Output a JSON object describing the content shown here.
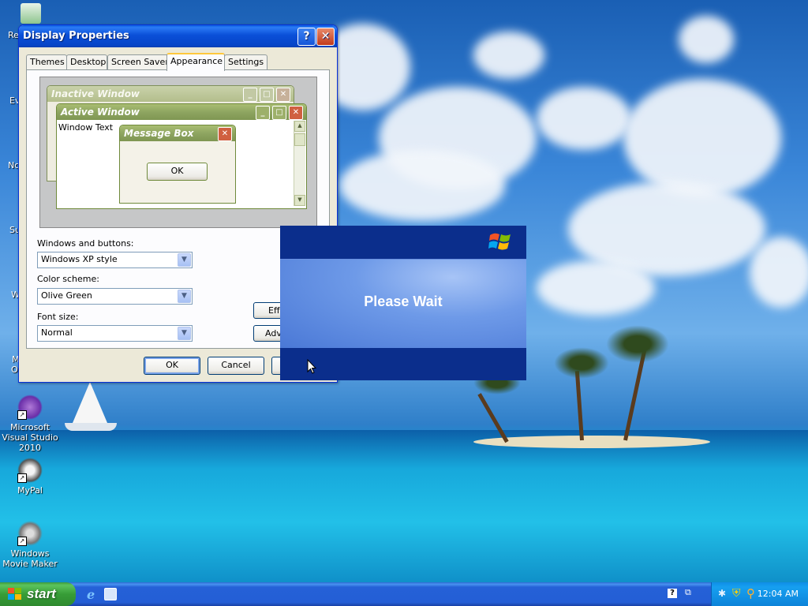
{
  "desktop": {
    "icons": [
      {
        "label": "Microsoft Visual Studio 2010"
      },
      {
        "label": "MyPal"
      },
      {
        "label": "Windows Movie Maker"
      }
    ],
    "partial_labels": [
      "Re",
      "Ev",
      "Nc",
      "Su",
      "W",
      "M",
      "O"
    ]
  },
  "display_properties": {
    "title": "Display Properties",
    "help_glyph": "?",
    "close_glyph": "✕",
    "tabs": [
      "Themes",
      "Desktop",
      "Screen Saver",
      "Appearance",
      "Settings"
    ],
    "active_tab": "Appearance",
    "preview": {
      "inactive_title": "Inactive Window",
      "active_title": "Active Window",
      "window_text": "Window Text",
      "msgbox_title": "Message Box",
      "msgbox_ok": "OK"
    },
    "windows_buttons_label": "Windows and buttons:",
    "windows_buttons_value": "Windows XP style",
    "color_scheme_label": "Color scheme:",
    "color_scheme_value": "Olive Green",
    "font_size_label": "Font size:",
    "font_size_value": "Normal",
    "effects_button": "Effe",
    "advanced_button": "Adv",
    "ok_button": "OK",
    "cancel_button": "Cancel"
  },
  "please_wait": {
    "message": "Please Wait"
  },
  "taskbar": {
    "start_label": "start",
    "clock": "12:04 AM"
  },
  "colors": {
    "olive_title": "#8ea561",
    "olive_active": "#a0b56a",
    "xp_blue": "#0a4fd8",
    "wait_dark": "#0b2e8c"
  }
}
